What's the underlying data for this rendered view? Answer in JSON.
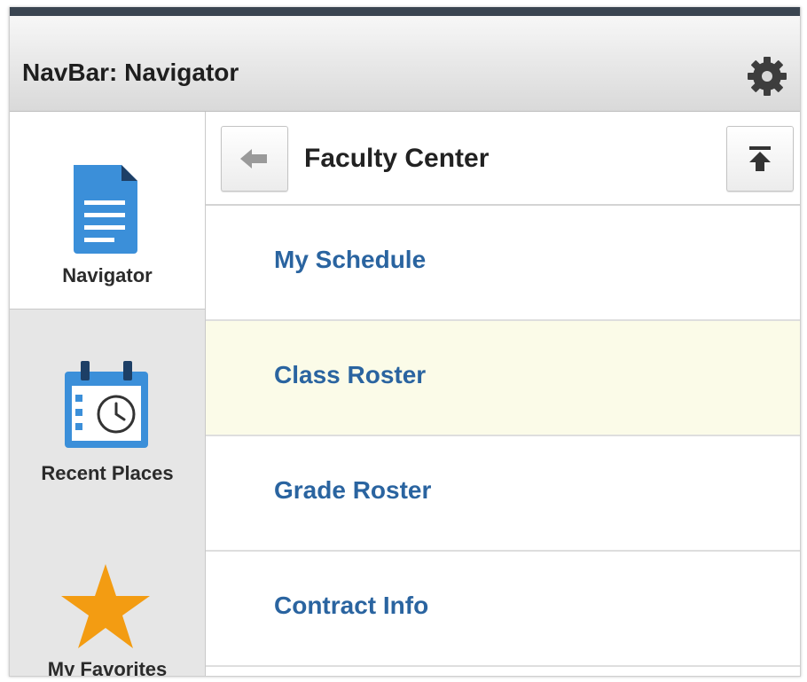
{
  "header": {
    "title": "NavBar: Navigator",
    "settings_icon": "gear-icon"
  },
  "sidebar": {
    "items": [
      {
        "label": "Navigator",
        "icon": "document-icon",
        "active": true
      },
      {
        "label": "Recent Places",
        "icon": "calendar-clock-icon",
        "active": false
      },
      {
        "label": "My Favorites",
        "icon": "star-icon",
        "active": false
      }
    ]
  },
  "main": {
    "folder_title": "Faculty Center",
    "back_icon": "back-arrow-icon",
    "top_icon": "arrow-to-top-icon",
    "items": [
      {
        "label": "My Schedule"
      },
      {
        "label": "Class Roster"
      },
      {
        "label": "Grade Roster"
      },
      {
        "label": "Contract Info"
      }
    ]
  },
  "colors": {
    "accent_blue": "#2a64a0",
    "icon_blue": "#3b8fd9",
    "star_orange": "#f39c12",
    "highlight_row": "#fbfbe8",
    "topbar": "#3a4551"
  }
}
